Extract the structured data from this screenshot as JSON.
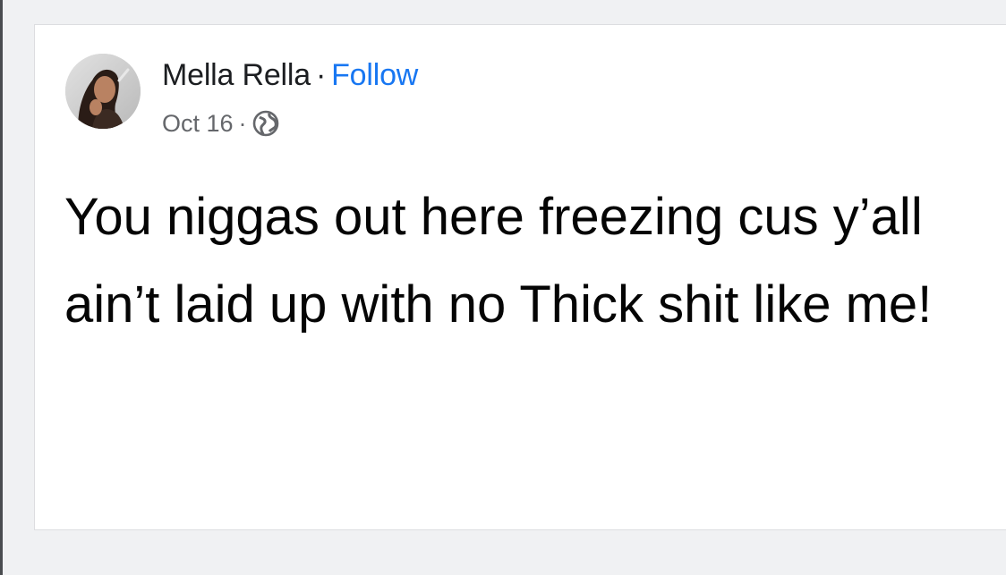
{
  "post": {
    "author": "Mella Rella",
    "separator": "·",
    "follow_label": "Follow",
    "date": "Oct 16",
    "meta_separator": "·",
    "audience_icon": "globe-icon",
    "text": "You niggas out here freezing cus y’all ain’t laid up with no Thick shit like me!"
  },
  "colors": {
    "follow": "#1877f2",
    "author": "#1c1e21",
    "meta": "#65676b",
    "text": "#050505"
  }
}
